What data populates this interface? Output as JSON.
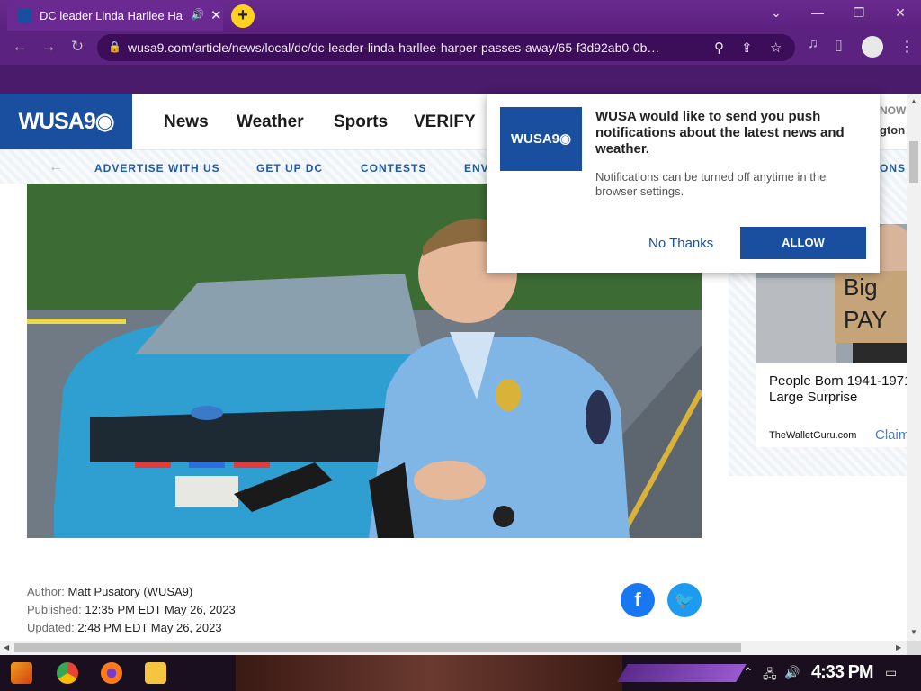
{
  "browser": {
    "tab_title": "DC leader Linda Harllee Ha",
    "url": "wusa9.com/article/news/local/dc/dc-leader-linda-harllee-harper-passes-away/65-f3d92ab0-0b…",
    "new_tab_symbol": "+",
    "window_minimize": "—",
    "window_maximize": "❐",
    "window_close": "✕"
  },
  "site": {
    "logo_text": "WUSA9◉",
    "nav": [
      "News",
      "Weather",
      "Sports",
      "VERIFY"
    ],
    "subnav": [
      "ADVERTISE WITH US",
      "GET UP DC",
      "CONTESTS",
      "ENV"
    ],
    "subnav_right": "ONS",
    "right_edge_top": "NOW",
    "right_edge_mid": "gton"
  },
  "article": {
    "author_label": "Author:",
    "author": "Matt Pusatory (WUSA9)",
    "published_label": "Published:",
    "published": "12:35 PM EDT May 26, 2023",
    "updated_label": "Updated:",
    "updated": "2:48 PM EDT May 26, 2023"
  },
  "ad": {
    "sign_text": "Big PAY",
    "headline": "People Born 1941-1971 Large Surprise",
    "source": "TheWalletGuru.com",
    "cta": "Claim"
  },
  "notification": {
    "logo_text": "WUSA9◉",
    "title": "WUSA would like to send you push notifications about the latest news and weather.",
    "subtitle": "Notifications can be turned off anytime in the browser settings.",
    "decline_label": "No Thanks",
    "accept_label": "ALLOW"
  },
  "taskbar": {
    "clock": "4:33 PM"
  },
  "colors": {
    "brand_blue": "#1a4fa0",
    "browser_purple": "#5c2280",
    "facebook": "#1877f2",
    "twitter": "#1d9bf0"
  },
  "icons": [
    "favicon-icon",
    "speaker-icon",
    "close-tab-icon",
    "back-icon",
    "forward-icon",
    "reload-icon",
    "lock-icon",
    "search-icon",
    "share-icon",
    "star-icon",
    "facebook-icon",
    "twitter-icon",
    "chrome-icon",
    "firefox-icon",
    "folder-icon"
  ]
}
